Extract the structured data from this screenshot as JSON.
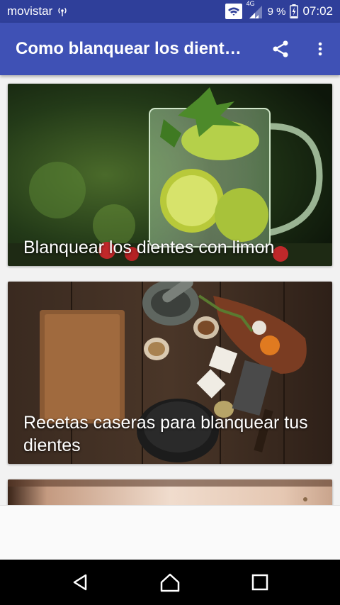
{
  "status_bar": {
    "carrier": "movistar",
    "network_type": "4G",
    "battery_percent": "9 %",
    "time": "07:02"
  },
  "app_bar": {
    "title": "Como blanquear los dientes con limon",
    "share_icon": "share-icon",
    "menu_icon": "more-vert-icon"
  },
  "articles": [
    {
      "title": "Blanquear los dientes con limon",
      "image": "glass-of-lemon-water-photo"
    },
    {
      "title": "Recetas caseras para blanquear tus dientes",
      "image": "spices-and-mortar-on-wooden-table-photo"
    },
    {
      "title": "",
      "image": "face-photo"
    }
  ],
  "nav_bar": {
    "back_icon": "back-icon",
    "home_icon": "home-icon",
    "recents_icon": "recents-icon"
  },
  "colors": {
    "primary": "#3f51b5",
    "primary_dark": "#2f3f9a",
    "nav_bar": "#000000"
  }
}
